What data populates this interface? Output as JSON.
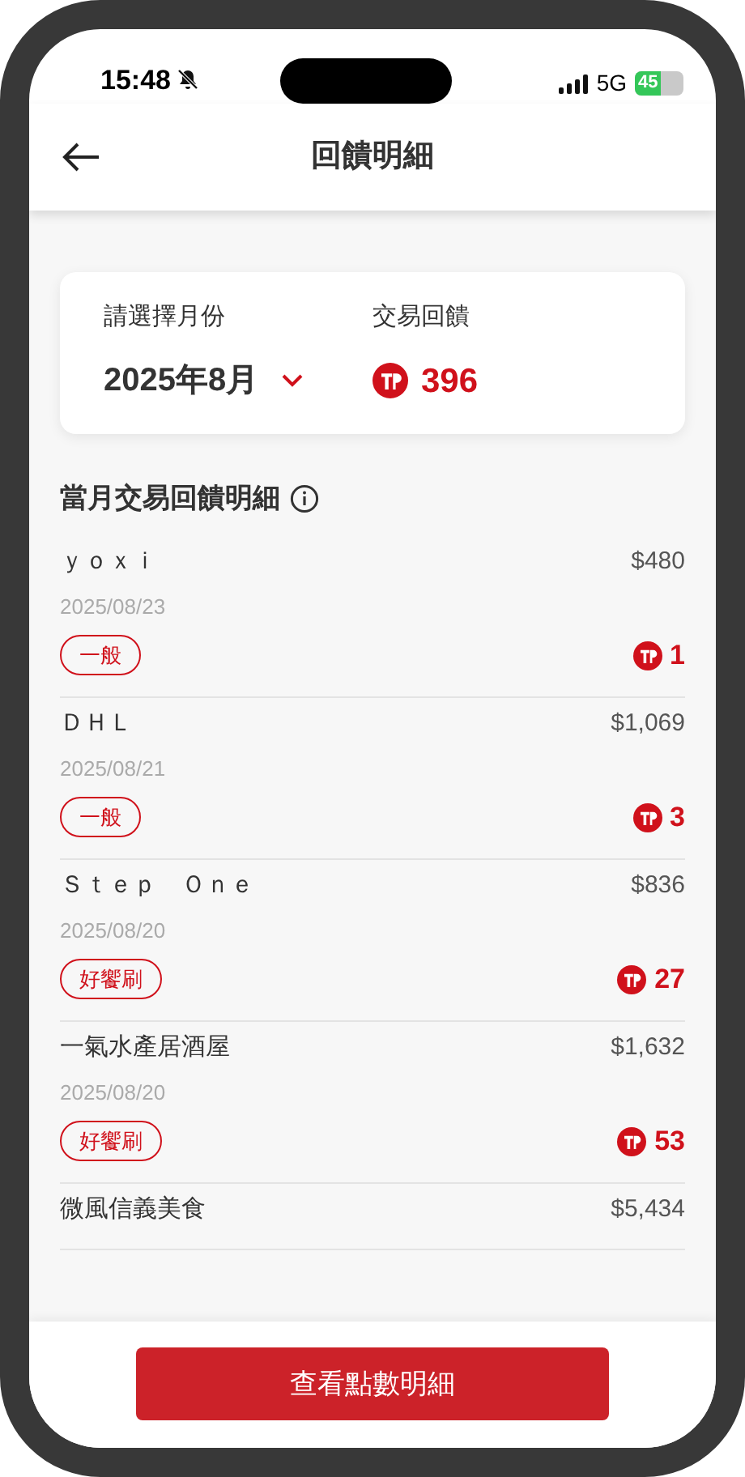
{
  "status_bar": {
    "time": "15:48",
    "network": "5G",
    "battery": "45"
  },
  "header": {
    "title": "回饋明細"
  },
  "summary": {
    "month_label": "請選擇月份",
    "month_value": "2025年8月",
    "reward_label": "交易回饋",
    "reward_value": "396"
  },
  "section_title": "當月交易回饋明細",
  "transactions": [
    {
      "name": "ｙｏｘｉ",
      "amount": "$480",
      "date": "2025/08/23",
      "tag": "一般",
      "points": "1"
    },
    {
      "name": "ＤＨＬ",
      "amount": "$1,069",
      "date": "2025/08/21",
      "tag": "一般",
      "points": "3"
    },
    {
      "name": "Ｓｔｅｐ　Ｏｎｅ",
      "amount": "$836",
      "date": "2025/08/20",
      "tag": "好饗刷",
      "points": "27"
    },
    {
      "name": "一氣水產居酒屋",
      "amount": "$1,632",
      "date": "2025/08/20",
      "tag": "好饗刷",
      "points": "53"
    },
    {
      "name": "微風信義美食",
      "amount": "$5,434"
    }
  ],
  "button": "查看點數明細"
}
